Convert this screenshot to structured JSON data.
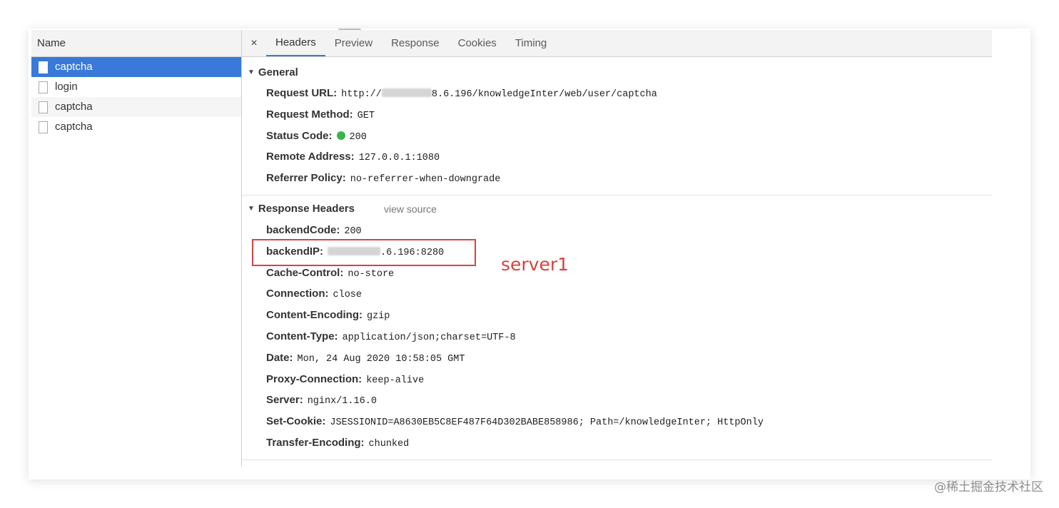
{
  "left": {
    "header": "Name",
    "requests": [
      "captcha",
      "login",
      "captcha",
      "captcha"
    ]
  },
  "tabs": {
    "close": "×",
    "items": [
      "Headers",
      "Preview",
      "Response",
      "Cookies",
      "Timing"
    ]
  },
  "general": {
    "title": "General",
    "rows": [
      {
        "key": "Request URL:",
        "value_suffix": "8.6.196/knowledgeInter/web/user/captcha",
        "value_prefix": "http://"
      },
      {
        "key": "Request Method:",
        "value": "GET"
      },
      {
        "key": "Status Code:",
        "value": "200"
      },
      {
        "key": "Remote Address:",
        "value": "127.0.0.1:1080"
      },
      {
        "key": "Referrer Policy:",
        "value": "no-referrer-when-downgrade"
      }
    ]
  },
  "response_headers": {
    "title": "Response Headers",
    "view_source": "view source",
    "rows": [
      {
        "key": "backendCode:",
        "value": "200"
      },
      {
        "key": "backendIP:",
        "value": ".6.196:8280"
      },
      {
        "key": "Cache-Control:",
        "value": "no-store"
      },
      {
        "key": "Connection:",
        "value": "close"
      },
      {
        "key": "Content-Encoding:",
        "value": "gzip"
      },
      {
        "key": "Content-Type:",
        "value": "application/json;charset=UTF-8"
      },
      {
        "key": "Date:",
        "value": "Mon, 24 Aug 2020 10:58:05 GMT"
      },
      {
        "key": "Proxy-Connection:",
        "value": "keep-alive"
      },
      {
        "key": "Server:",
        "value": "nginx/1.16.0"
      },
      {
        "key": "Set-Cookie:",
        "value": "JSESSIONID=A8630EB5C8EF487F64D302BABE858986; Path=/knowledgeInter; HttpOnly"
      },
      {
        "key": "Transfer-Encoding:",
        "value": "chunked"
      }
    ]
  },
  "annotation": "server1",
  "watermark": "@稀土掘金技术社区",
  "colors": {
    "accent": "#3879d9",
    "status_ok": "#3bb54a",
    "annotation": "#d8413d"
  }
}
